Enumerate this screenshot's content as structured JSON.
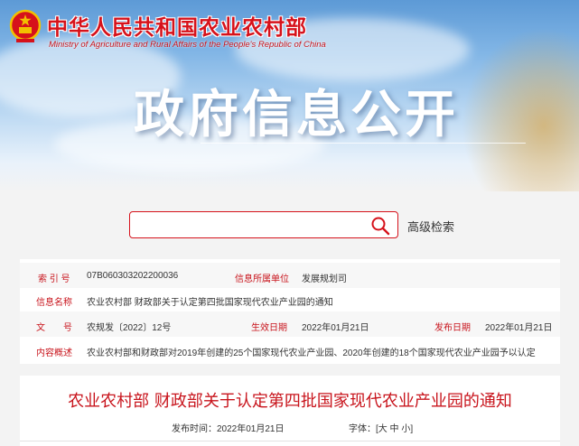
{
  "header": {
    "ministry_cn": "中华人民共和国农业农村部",
    "ministry_en": "Ministry of Agriculture and Rural Affairs of the People's Republic of China",
    "banner_title": "政府信息公开"
  },
  "search": {
    "placeholder": "",
    "advanced_label": "高级检索"
  },
  "info": {
    "index_label": "索 引 号",
    "index_value": "07B060303202200036",
    "unit_label": "信息所属单位",
    "unit_value": "发展规划司",
    "name_label": "信息名称",
    "name_value": "农业农村部 财政部关于认定第四批国家现代农业产业园的通知",
    "doc_label": "文　　号",
    "doc_value": "农规发〔2022〕12号",
    "effective_label": "生效日期",
    "effective_value": "2022年01月21日",
    "publish_label": "发布日期",
    "publish_value": "2022年01月21日",
    "summary_label": "内容概述",
    "summary_value": "农业农村部和财政部对2019年创建的25个国家现代农业产业园、2020年创建的18个国家现代农业产业园予以认定"
  },
  "article": {
    "title": "农业农村部 财政部关于认定第四批国家现代农业产业园的通知",
    "publish_time": "发布时间：2022年01月21日",
    "font_size_label": "字体：[大 中 小]"
  },
  "colors": {
    "brand_red": "#c8141c",
    "accent_red": "#d6121b"
  },
  "icons": {
    "search": "search-icon",
    "emblem": "national-emblem-icon"
  }
}
